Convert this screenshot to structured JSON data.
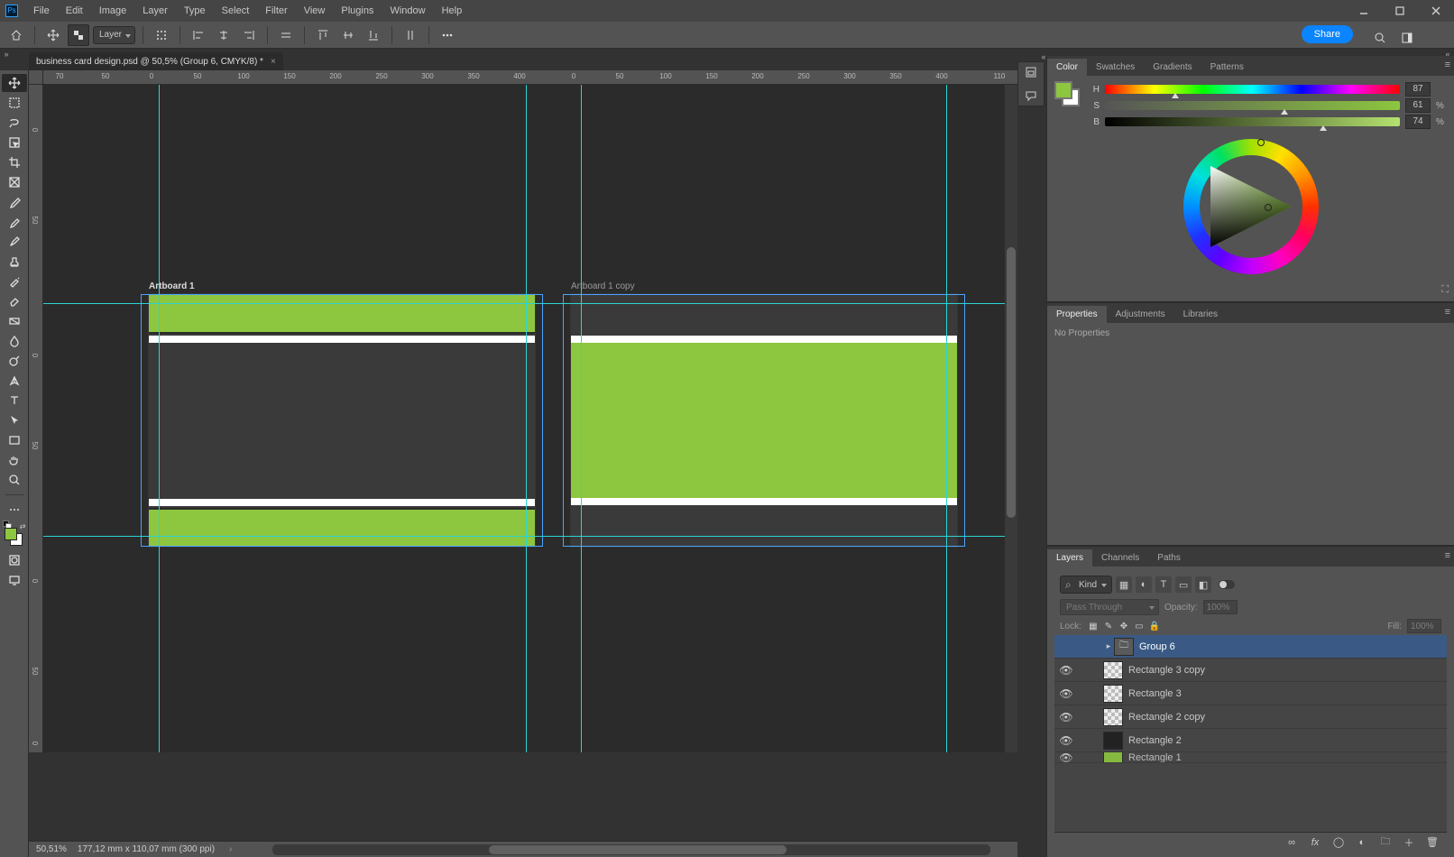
{
  "app_icon_label": "Ps",
  "menubar": [
    "File",
    "Edit",
    "Image",
    "Layer",
    "Type",
    "Select",
    "Filter",
    "View",
    "Plugins",
    "Window",
    "Help"
  ],
  "optbar": {
    "layer_mode": "Layer",
    "share": "Share"
  },
  "document": {
    "tab_title": "business card design.psd @ 50,5% (Group 6, CMYK/8) *"
  },
  "ruler_h": [
    "70",
    "50",
    "0",
    "50",
    "100",
    "150",
    "200",
    "250",
    "300",
    "350",
    "400",
    "0",
    "50",
    "100",
    "150",
    "200",
    "250",
    "300",
    "350",
    "400",
    "110"
  ],
  "ruler_v": [
    "0",
    "50",
    "0",
    "50",
    "0",
    "50",
    "0"
  ],
  "artboards": {
    "a1_label": "Artboard 1",
    "a2_label": "Artboard 1 copy"
  },
  "panels": {
    "color": {
      "tabs": [
        "Color",
        "Swatches",
        "Gradients",
        "Patterns"
      ],
      "h": {
        "label": "H",
        "value": "87"
      },
      "s": {
        "label": "S",
        "value": "61",
        "unit": "%"
      },
      "b": {
        "label": "B",
        "value": "74",
        "unit": "%"
      },
      "accent_hex": "#8dc63f"
    },
    "properties": {
      "tabs": [
        "Properties",
        "Adjustments",
        "Libraries"
      ],
      "empty_text": "No Properties"
    },
    "layers": {
      "tabs": [
        "Layers",
        "Channels",
        "Paths"
      ],
      "filter_kind": "Kind",
      "blend_mode": "Pass Through",
      "opacity_label": "Opacity:",
      "opacity_value": "100%",
      "lock_label": "Lock:",
      "fill_label": "Fill:",
      "fill_value": "100%",
      "rows": [
        {
          "name": "Group 6",
          "type": "group",
          "selected": true,
          "visible": false
        },
        {
          "name": "Rectangle 3 copy",
          "type": "shape",
          "selected": false,
          "visible": true
        },
        {
          "name": "Rectangle 3",
          "type": "shape",
          "selected": false,
          "visible": true
        },
        {
          "name": "Rectangle 2 copy",
          "type": "shape",
          "selected": false,
          "visible": true
        },
        {
          "name": "Rectangle 2",
          "type": "shape2",
          "selected": false,
          "visible": true
        },
        {
          "name": "Rectangle 1",
          "type": "shape3",
          "selected": false,
          "visible": true
        }
      ]
    }
  },
  "statusbar": {
    "zoom": "50,51%",
    "docinfo": "177,12 mm x 110,07 mm (300 ppi)"
  }
}
